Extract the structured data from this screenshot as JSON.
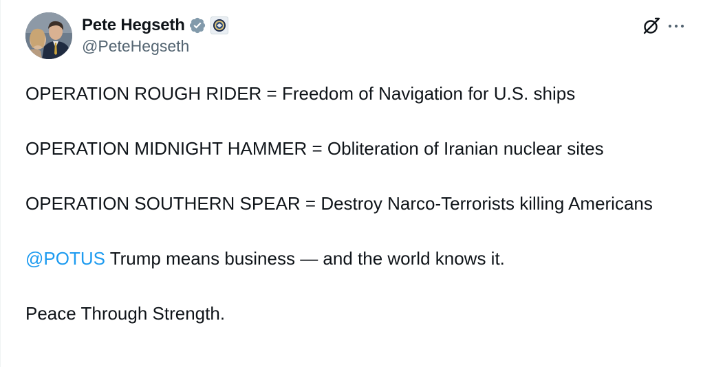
{
  "author": {
    "display_name": "Pete Hegseth",
    "handle": "@PeteHegseth",
    "verified": true
  },
  "icons": {
    "verified": "verified-badge-icon",
    "affiliate": "dod-seal-icon",
    "grok": "grok-icon",
    "more": "more-options-icon",
    "verified_color": "#829aab"
  },
  "tweet": {
    "line1": "OPERATION ROUGH RIDER = Freedom of Navigation for U.S. ships",
    "line2": "OPERATION MIDNIGHT HAMMER = Obliteration of Iranian nuclear sites",
    "line3": "OPERATION SOUTHERN SPEAR = Destroy Narco-Terrorists killing Americans",
    "mention": "@POTUS",
    "line4_rest": " Trump means business — and the world knows it.",
    "line5": "Peace Through Strength."
  },
  "colors": {
    "text": "#0f1419",
    "secondary": "#536471",
    "link": "#1d9bf0"
  }
}
